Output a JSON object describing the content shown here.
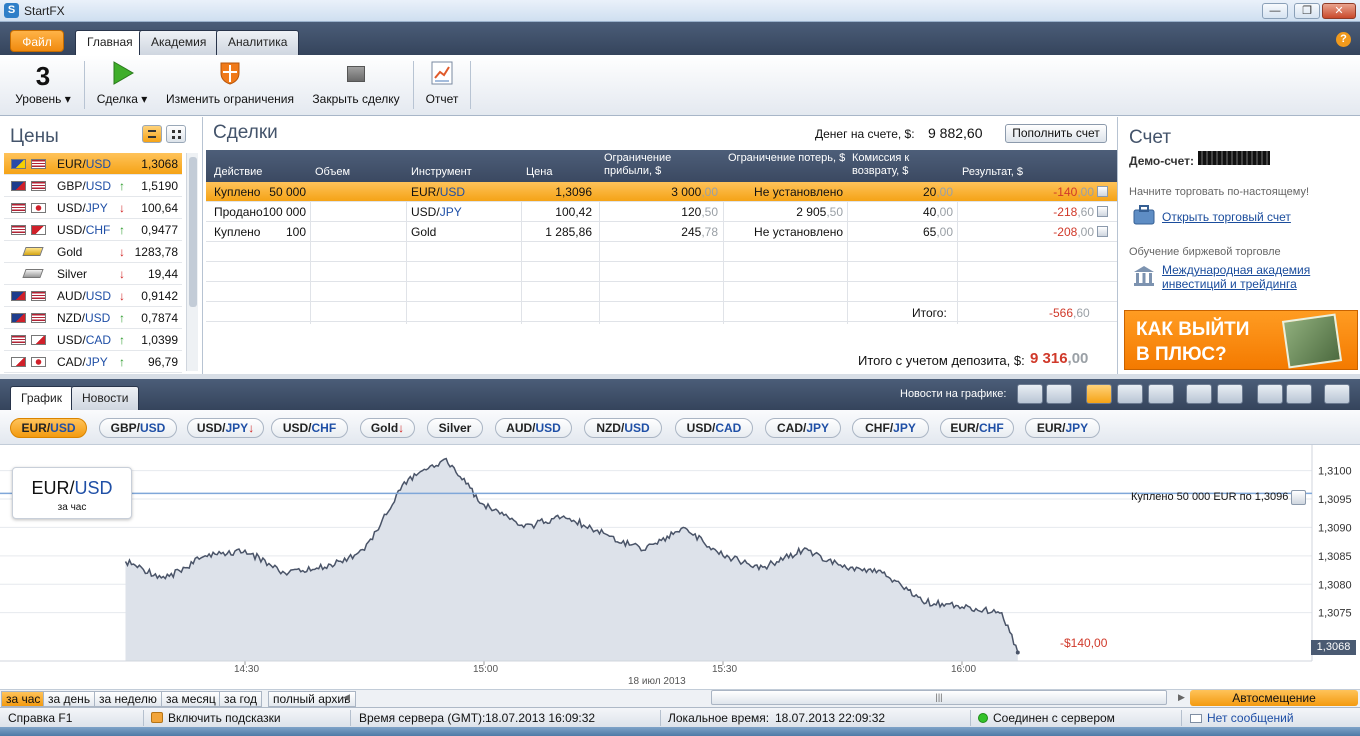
{
  "window": {
    "title": "StartFX",
    "logo": "S",
    "min": "—",
    "max": "❐",
    "close": "✕"
  },
  "ribbon": {
    "file": "Файл",
    "tabs": [
      "Главная",
      "Академия",
      "Аналитика"
    ],
    "help": "?"
  },
  "toolbar": {
    "level_value": "3",
    "level": "Уровень ▾",
    "deal": "Сделка ▾",
    "change_limits": "Изменить ограничения",
    "close_deal": "Закрыть сделку",
    "report": "Отчет"
  },
  "prices": {
    "title": "Цены",
    "items": [
      {
        "name": "EUR/USD",
        "dir": "",
        "value": "1,3068"
      },
      {
        "name": "GBP/USD",
        "dir": "up",
        "value": "1,5190"
      },
      {
        "name": "USD/JPY",
        "dir": "down",
        "value": "100,64"
      },
      {
        "name": "USD/CHF",
        "dir": "up",
        "value": "0,9477"
      },
      {
        "name": "Gold",
        "dir": "down",
        "value": "1283,78"
      },
      {
        "name": "Silver",
        "dir": "down",
        "value": "19,44"
      },
      {
        "name": "AUD/USD",
        "dir": "down",
        "value": "0,9142"
      },
      {
        "name": "NZD/USD",
        "dir": "up",
        "value": "0,7874"
      },
      {
        "name": "USD/CAD",
        "dir": "up",
        "value": "1,0399"
      },
      {
        "name": "CAD/JPY",
        "dir": "up",
        "value": "96,79"
      }
    ]
  },
  "trades": {
    "title": "Сделки",
    "balance_label": "Денег на счете, $:",
    "balance": "9 882,60",
    "topup": "Пополнить счет",
    "columns": [
      "Действие",
      "Объем",
      "Инструмент",
      "Цена",
      "Ограничение прибыли, $",
      "Ограничение потерь, $",
      "Комиссия к возврату, $",
      "Результат, $"
    ],
    "rows": [
      {
        "action": "Куплено",
        "volume": "50 000",
        "instr": "EUR/USD",
        "price": "1,3096",
        "tp": "3 000",
        "tp_dec": ",00",
        "sl": "Не установлено",
        "sl_dec": "",
        "comm": "20",
        "comm_dec": ",00",
        "res": "-140",
        "res_dec": ",00"
      },
      {
        "action": "Продано",
        "volume": "100 000",
        "instr": "USD/JPY",
        "price": "100,42",
        "tp": "120",
        "tp_dec": ",50",
        "sl": "2 905",
        "sl_dec": ",50",
        "comm": "40",
        "comm_dec": ",00",
        "res": "-218",
        "res_dec": ",60"
      },
      {
        "action": "Куплено",
        "volume": "100",
        "instr": "Gold",
        "price": "1 285,86",
        "tp": "245",
        "tp_dec": ",78",
        "sl": "Не установлено",
        "sl_dec": "",
        "comm": "65",
        "comm_dec": ",00",
        "res": "-208",
        "res_dec": ",00"
      }
    ],
    "total_label": "Итого:",
    "total": "-566",
    "total_dec": ",60",
    "deposit_label": "Итого с учетом депозита, $:",
    "deposit": "9 316",
    "deposit_dec": ",00"
  },
  "account": {
    "title": "Счет",
    "demo_label": "Демо-счет:",
    "real_hint": "Начните торговать по-настоящему!",
    "open_account": "Открыть торговый счет",
    "edu_label": "Обучение биржевой торговле",
    "academy": "Международная академия инвестиций и трейдинга",
    "banner": "КАК ВЫЙТИ В ПЛЮС?"
  },
  "chart_tabs": [
    "График",
    "Новости"
  ],
  "news_on_chart": "Новости на графике:",
  "pairs": [
    {
      "label": "EUR/USD",
      "arrow": ""
    },
    {
      "label": "GBP/USD",
      "arrow": ""
    },
    {
      "label": "USD/JPY",
      "arrow": "↓"
    },
    {
      "label": "USD/CHF",
      "arrow": ""
    },
    {
      "label": "Gold",
      "arrow": "↓"
    },
    {
      "label": "Silver",
      "arrow": ""
    },
    {
      "label": "AUD/USD",
      "arrow": ""
    },
    {
      "label": "NZD/USD",
      "arrow": ""
    },
    {
      "label": "USD/CAD",
      "arrow": ""
    },
    {
      "label": "CAD/JPY",
      "arrow": ""
    },
    {
      "label": "CHF/JPY",
      "arrow": ""
    },
    {
      "label": "EUR/CHF",
      "arrow": ""
    },
    {
      "label": "EUR/JPY",
      "arrow": ""
    }
  ],
  "chart": {
    "pair": "EUR/USD",
    "period": "за час",
    "position_label": "Куплено 50 000 EUR по 1,3096",
    "pnl": "-$140,00",
    "current": "1,3068",
    "date": "18 июл 2013"
  },
  "chart_data": {
    "type": "line",
    "title": "EUR/USD",
    "subtitle": "за час",
    "x": [
      "14:15",
      "14:20",
      "14:25",
      "14:30",
      "14:35",
      "14:40",
      "14:45",
      "14:50",
      "14:55",
      "15:00",
      "15:05",
      "15:10",
      "15:15",
      "15:20",
      "15:25",
      "15:30",
      "15:35",
      "15:40",
      "15:45",
      "15:50",
      "15:55",
      "16:00",
      "16:05",
      "16:07"
    ],
    "y": [
      1.3084,
      1.3081,
      1.3085,
      1.3086,
      1.3082,
      1.3083,
      1.3086,
      1.3098,
      1.3102,
      1.3094,
      1.309,
      1.3092,
      1.3089,
      1.3086,
      1.309,
      1.3085,
      1.3083,
      1.3086,
      1.3083,
      1.3082,
      1.3077,
      1.3076,
      1.3075,
      1.3068
    ],
    "x_ticks": [
      "14:30",
      "15:00",
      "15:30",
      "16:00"
    ],
    "y_ticks": [
      "1,3100",
      "1,3095",
      "1,3090",
      "1,3085",
      "1,3080",
      "1,3075"
    ],
    "ylim": [
      1.30665,
      1.31045
    ],
    "position_line": 1.3096,
    "colors": {
      "line": "#4a5468",
      "area": "#dde2ea",
      "position_line": "#7fa7d9"
    }
  },
  "range": {
    "items": [
      "за час",
      "за день",
      "за неделю",
      "за месяц",
      "за год",
      "полный архив"
    ],
    "autoshift": "Автосмещение"
  },
  "status": {
    "help": "Справка F1",
    "hints": "Включить подсказки",
    "server_time_label": "Время сервера (GMT):",
    "server_time": "18.07.2013 16:09:32",
    "local_time_label": "Локальное время:",
    "local_time": "18.07.2013 22:09:32",
    "connected": "Соединен с сервером",
    "messages": "Нет сообщений"
  }
}
